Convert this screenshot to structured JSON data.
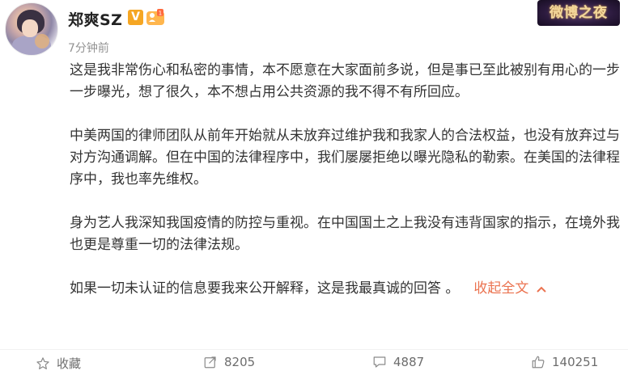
{
  "post": {
    "username": "郑爽SZ",
    "vip_badge": "V",
    "timestamp": "7分钟前",
    "event_badge": "微博之夜",
    "paragraphs": [
      "这是我非常伤心和私密的事情，本不愿意在大家面前多说，但是事已至此被别有用心的一步一步曝光，想了很久，本不想占用公共资源的我不得不有所回应。",
      "中美两国的律师团队从前年开始就从未放弃过维护我和我家人的合法权益，也没有放弃过与对方沟通调解。但在中国的法律程序中，我们屡屡拒绝以曝光隐私的勒索。在美国的法律程序中，我也率先维权。",
      "身为艺人我深知我国疫情的防控与重视。在中国国土之上我没有违背国家的指示，在境外我也更是尊重一切的法律法规。",
      "如果一切未认证的信息要我来公开解释，这是我最真诚的回答 。"
    ],
    "collapse_label": "收起全文",
    "collapse_icon": "chevron-up-icon"
  },
  "actions": {
    "favorite_label": "收藏",
    "share_count": "8205",
    "comment_count": "4887",
    "like_count": "140251"
  },
  "colors": {
    "accent": "#eb7350",
    "text": "#333333",
    "meta": "#939393",
    "action": "#6d6d6d"
  }
}
